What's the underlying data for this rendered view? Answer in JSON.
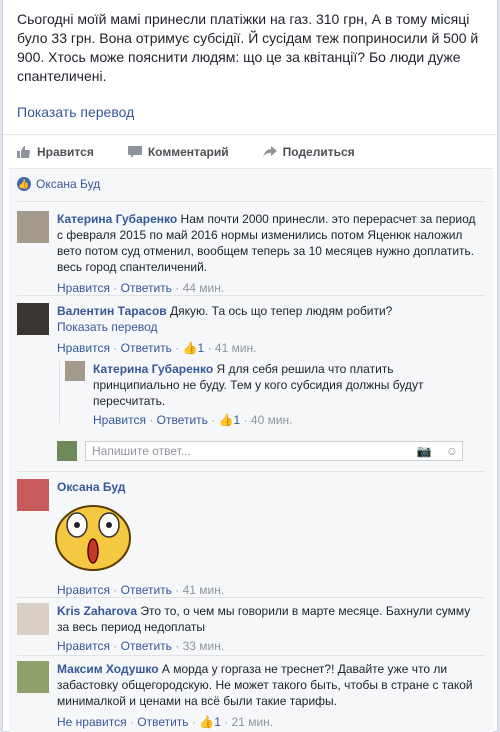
{
  "post": {
    "text": "Сьогодні моїй мамі принесли платіжки на газ. 310 грн, А в тому місяці було 33 грн. Вона отримує субсідії. Й сусідам теж поприносили й 500 й 900. Хтось може пояснити людям: що це за квітанції? Бо люди дуже спантеличені.",
    "see_translation": "Показать перевод"
  },
  "actions": {
    "like": "Нравится",
    "comment": "Комментарий",
    "share": "Поделиться"
  },
  "likes": {
    "name": "Оксана Буд"
  },
  "comments": [
    {
      "author": "Катерина Губаренко",
      "text": "Нам почти 2000 принесли. это перерасчет за период с февраля 2015 по май 2016 нормы изменились потом Яценюк наложил вето потом суд отменил, вообщем теперь за 10 месяцев нужно доплатить. весь город спантеличений.",
      "like": "Нравится",
      "reply": "Ответить",
      "time": "44 мин."
    },
    {
      "author": "Валентин Тарасов",
      "text": "Дякую. Та ось що тепер людям робити?",
      "see_translation": "Показать перевод",
      "like": "Нравится",
      "reply": "Ответить",
      "likes_count": "1",
      "time": "41 мин."
    },
    {
      "author": "Катерина Губаренко",
      "text": "Я для себя решила что платить принципиально не буду. Тем у кого субсидия должны будут пересчитать.",
      "like": "Нравится",
      "reply": "Ответить",
      "likes_count": "1",
      "time": "40 мин."
    },
    {
      "author": "Оксана Буд",
      "like": "Нравится",
      "reply": "Ответить",
      "time": "41 мин."
    },
    {
      "author": "Kris Zaharova",
      "text": "Это то, о чем мы говорили в марте месяце. Бахнули сумму за весь период недоплаты",
      "like": "Нравится",
      "reply": "Ответить",
      "time": "33 мин."
    },
    {
      "author": "Максим Ходушко",
      "text": "А морда у горгаза не треснет?! Давайте уже что ли забастовку общегородскую. Не может такого быть, чтобы в стране с такой минималкой и ценами на всё были такие тарифы.",
      "like": "Не нравится",
      "reply": "Ответить",
      "likes_count": "1",
      "time": "21 мин."
    }
  ],
  "reply_input": {
    "placeholder": "Напишите ответ..."
  },
  "colors": {
    "link": "#365899",
    "like_badge": "#4267b2",
    "meta": "#90949c"
  }
}
